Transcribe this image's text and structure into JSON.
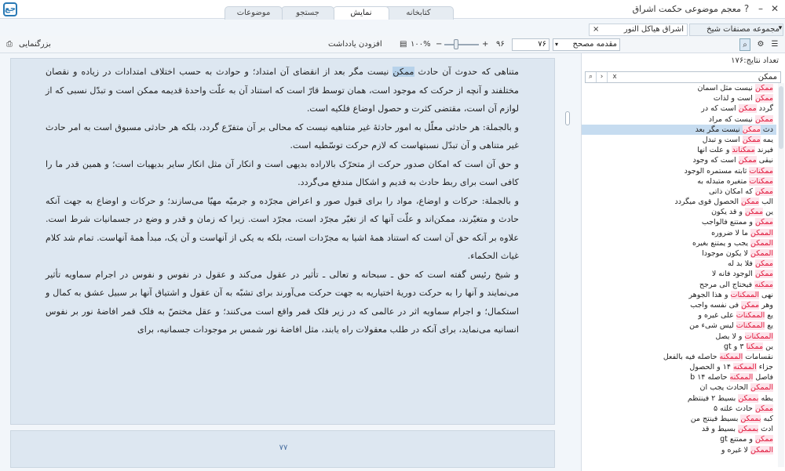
{
  "window": {
    "title": "معجم موضوعی حکمت اشراق",
    "logo_text": "جع"
  },
  "tabs": [
    {
      "label": "کتابخانه"
    },
    {
      "label": "نمایش"
    },
    {
      "label": "جستجو"
    },
    {
      "label": "موضوعات"
    }
  ],
  "doc_tabs": [
    {
      "label": "مجموعه مصنفات شیخ اشراق"
    },
    {
      "label": "اشراق هیاکل النور"
    }
  ],
  "toolbar": {
    "zoom_label": "بزرگنمایی",
    "add_note": "افزودن یادداشت",
    "zoom_value": "۱۰۰%",
    "minus": "−",
    "plus": "+",
    "page_current": "۷۶",
    "page_total": "۹۶",
    "section_select": "مقدمه مصحح"
  },
  "reader": {
    "paragraphs": [
      "متناهی که حدوث آن حادث ",
      "ممکن",
      " نیست مگر بعد از انقضای آن امتداد؛ و حوادث به حسب اختلاف امتدادات در زیاده و نقصان مختلفند و آنچه از حرکت که موجود است، همان توسط قارّ است که استناد آن به علّت واحدهٔ قدیمه ممکن است و تبدّل نسبی که از لوازم آن است، مقتضی کثرت و حصول اوضاع فلکیه است.",
      "و بالجملة: هر حادثی معلّل به امور حادثهٔ غیر متناهیه نیست که محالی بر آن متفرّع گردد، بلکه هر حادثی مسبوق است به امر حادث غیر متناهی و آن تبدّل نسبتهاست که لازم حرکت توسّطیه است.",
      "و حق آن است که امکان صدور حرکت از متحرّک بالاراده بدیهی است و انکار آن مثل انکار سایر بدیهیات است؛ و همین قدر ما را کافی است برای ربط حادث به قدیم و اشکال مندفع می‌گردد.",
      "و بالجملة: حرکات و اوضاع، مواد را برای قبول صور و اعراض مجرّده و جرمیّه مهیّا می‌سازند؛ و حرکات و اوضاع به جهت آنکه حادث و متغیّرند، ممکن‌اند و علّت آنها که از تغیّر مجرّد است، مجرّد است. زیرا که زمان و قدر و وضع در جسمانیات شرط است. علاوه بر آنکه حق آن است که استناد همهٔ اشیا به مجرّدات است، بلکه به یکی از آنهاست و آن یک، مبدأ همهٔ آنهاست. تمام شد کلام غیاث الحکماء.",
      "و شیخ رئیس گفته است که حق ـ سبحانه و تعالی ـ تأثیر در عقول می‌کند و عقول در نفوس و نفوس در اجرام سماویه تأثیر می‌نمایند و آنها را به حرکت دوریهٔ اختیاریه به جهت حرکت می‌آورند برای تشبّه به آن عقول و اشتیاق آنها بر سبیل عشق به کمال و استکمال؛ و اجرام سماویه اثر در عالمی که در زیر فلک قمر واقع است می‌کنند؛ و عقل مختصّ به فلک قمر افاضهٔ نور بر نفوس انسانیه می‌نماید، برای آنکه در طلب معقولات راه یابند، مثل افاضهٔ نور شمس بر موجودات جسمانیه، برای"
    ],
    "page_number": "۷۷"
  },
  "search_panel": {
    "result_count": "تعداد نتایج:۱۷۶",
    "query": "ممکن",
    "clear": "x",
    "results": [
      {
        "pre": "",
        "kw": "ممکن",
        "post": " نیست مثل اسمان"
      },
      {
        "pre": "",
        "kw": "ممکن",
        "post": " است و لذات"
      },
      {
        "pre": "گردد ",
        "kw": "ممکن",
        "post": " است که در"
      },
      {
        "pre": "",
        "kw": "ممکن",
        "post": " نیست که مراد"
      },
      {
        "pre": "دث ",
        "kw": "ممکن",
        "post": " نیست مگر بعد"
      },
      {
        "pre": "یمه ",
        "kw": "ممکن",
        "post": " است و تبدل"
      },
      {
        "pre": "فیرند ",
        "kw": "ممکناند",
        "post": " و علت انها"
      },
      {
        "pre": "نیقی ",
        "kw": "ممکن",
        "post": " است که وجود"
      },
      {
        "pre": "",
        "kw": "ممکنات",
        "post": " ثابته مستمره الوجود"
      },
      {
        "pre": "",
        "kw": "ممکنات",
        "post": " متغیره متبدله به"
      },
      {
        "pre": "",
        "kw": "ممکن",
        "post": " که امکان ذاتی"
      },
      {
        "pre": "الب ",
        "kw": "ممکن",
        "post": " الحصول قوی میگردد"
      },
      {
        "pre": "ین ",
        "kw": "ممکن",
        "post": " و قد یکون"
      },
      {
        "pre": "",
        "kw": "ممکن",
        "post": " و ممتنع فالواجب"
      },
      {
        "pre": "",
        "kw": "الممکن",
        "post": " ما لا ضروره"
      },
      {
        "pre": "",
        "kw": "الممکن",
        "post": " یجب و یمتنع بغیره"
      },
      {
        "pre": "",
        "kw": "الممکن",
        "post": " لا یکون موجودا"
      },
      {
        "pre": "",
        "kw": "ممکن",
        "post": " فلا بد له"
      },
      {
        "pre": "",
        "kw": "ممکن",
        "post": " الوجود فانه لا"
      },
      {
        "pre": "",
        "kw": "ممکنه",
        "post": " فیحتاج الی مرجح"
      },
      {
        "pre": "نهی ",
        "kw": "الممکنات",
        "post": " و هذا الجوهر"
      },
      {
        "pre": "وهر ",
        "kw": "ممکن",
        "post": " فی نفسه واجب"
      },
      {
        "pre": "یع ",
        "kw": "الممکنات",
        "post": " علی غیره و"
      },
      {
        "pre": "یع ",
        "kw": "الممکنات",
        "post": " لیس شیء من"
      },
      {
        "pre": "",
        "kw": "الممکنات",
        "post": " و لا یصل"
      },
      {
        "pre": "ین ",
        "kw": "ممکنا",
        "post": " ۳ و gt"
      },
      {
        "pre": "نقسامات ",
        "kw": "الممکنه",
        "post": " حاصله فیه بالفعل"
      },
      {
        "pre": "جزاء ",
        "kw": "الممکنه",
        "post": " ۱۴ و الحصول"
      },
      {
        "pre": "فاصل ",
        "kw": "الممکنه",
        "post": " حاصله ۱۴ b"
      },
      {
        "pre": "",
        "kw": "الممکن",
        "post": " الحادث یجب ان"
      },
      {
        "pre": "یطه ",
        "kw": "بممکن",
        "post": " بسیط ۲ فینتظم"
      },
      {
        "pre": "",
        "kw": "ممکن",
        "post": " حادث علته ۵"
      },
      {
        "pre": "کبه ",
        "kw": "بممکن",
        "post": " بسیط فینتج من"
      },
      {
        "pre": "ادث ",
        "kw": "بممکن",
        "post": " بسیط و قد"
      },
      {
        "pre": "",
        "kw": "ممکن",
        "post": " و ممتنع gt"
      },
      {
        "pre": "",
        "kw": "الممکن",
        "post": " لا غیره و"
      }
    ]
  }
}
